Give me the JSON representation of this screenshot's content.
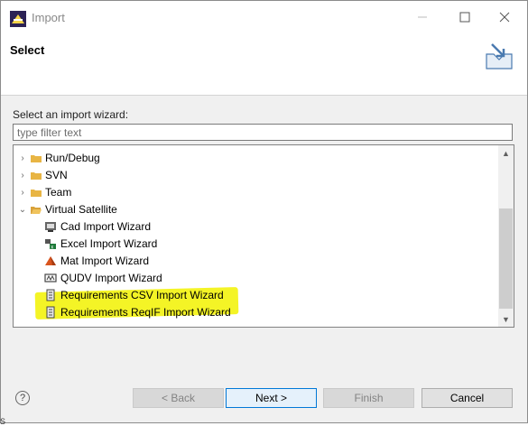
{
  "window": {
    "title": "Import"
  },
  "header": {
    "title": "Select"
  },
  "content": {
    "wizard_label": "Select an import wizard:",
    "filter_placeholder": "type filter text"
  },
  "tree": {
    "items": [
      {
        "label": "Run/Debug",
        "state": "collapsed",
        "icon": "folder-icon"
      },
      {
        "label": "SVN",
        "state": "collapsed",
        "icon": "folder-icon"
      },
      {
        "label": "Team",
        "state": "collapsed",
        "icon": "folder-icon"
      },
      {
        "label": "Virtual Satellite",
        "state": "expanded",
        "icon": "folder-open-icon"
      },
      {
        "label": "Cad Import Wizard",
        "icon": "cad-icon"
      },
      {
        "label": "Excel Import Wizard",
        "icon": "excel-icon"
      },
      {
        "label": "Mat Import Wizard",
        "icon": "mat-icon"
      },
      {
        "label": "QUDV Import Wizard",
        "icon": "qudv-icon"
      },
      {
        "label": "Requirements CSV Import Wizard",
        "icon": "requirements-icon"
      },
      {
        "label": "Requirements ReqIF Import Wizard",
        "icon": "requirements-icon",
        "highlighted": true
      }
    ]
  },
  "footer": {
    "help": "?",
    "back": "< Back",
    "next": "Next >",
    "finish": "Finish",
    "cancel": "Cancel"
  },
  "colors": {
    "highlight": "#f2f200",
    "folder": "#e8b544",
    "default_button_border": "#0078d7"
  },
  "corner_fragment": "S"
}
